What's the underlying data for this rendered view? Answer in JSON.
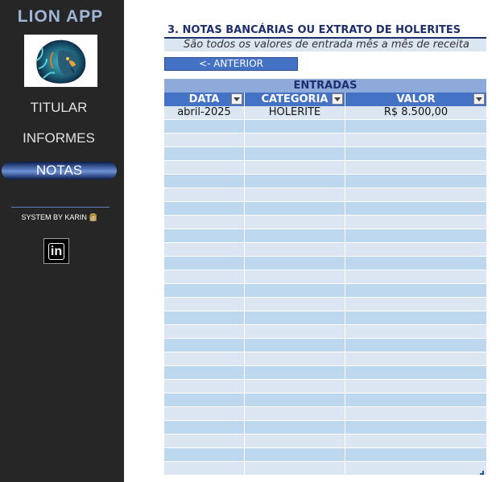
{
  "sidebar": {
    "app_title": "LION APP",
    "logo": "lion-head-logo",
    "nav": [
      {
        "label": "TITULAR"
      },
      {
        "label": "INFORMES"
      },
      {
        "label": "NOTAS",
        "active": true
      }
    ],
    "system_by": "SYSTEM BY KARIN 👩🏼",
    "linkedin_icon": "linkedin-icon",
    "linkedin_text": "in"
  },
  "main": {
    "section_title": "3. NOTAS BANCÁRIAS OU EXTRATO DE HOLERITES",
    "subtitle": "São todos os valores de entrada mês a mês de receita",
    "back_button": "<- ANTERIOR",
    "table": {
      "caption": "ENTRADAS",
      "columns": [
        "DATA",
        "CATEGORIA",
        "VALOR"
      ],
      "rows": [
        [
          "abril-2025",
          "HOLERITE",
          "R$ 8.500,00"
        ]
      ],
      "empty_rows": 26
    }
  },
  "colors": {
    "sidebar_bg": "#262626",
    "header_blue": "#4472c4",
    "caption_blue": "#8eaadb",
    "row_light": "#dce6f2",
    "row_dark": "#bdd7ee",
    "title_navy": "#1f2f6e"
  }
}
